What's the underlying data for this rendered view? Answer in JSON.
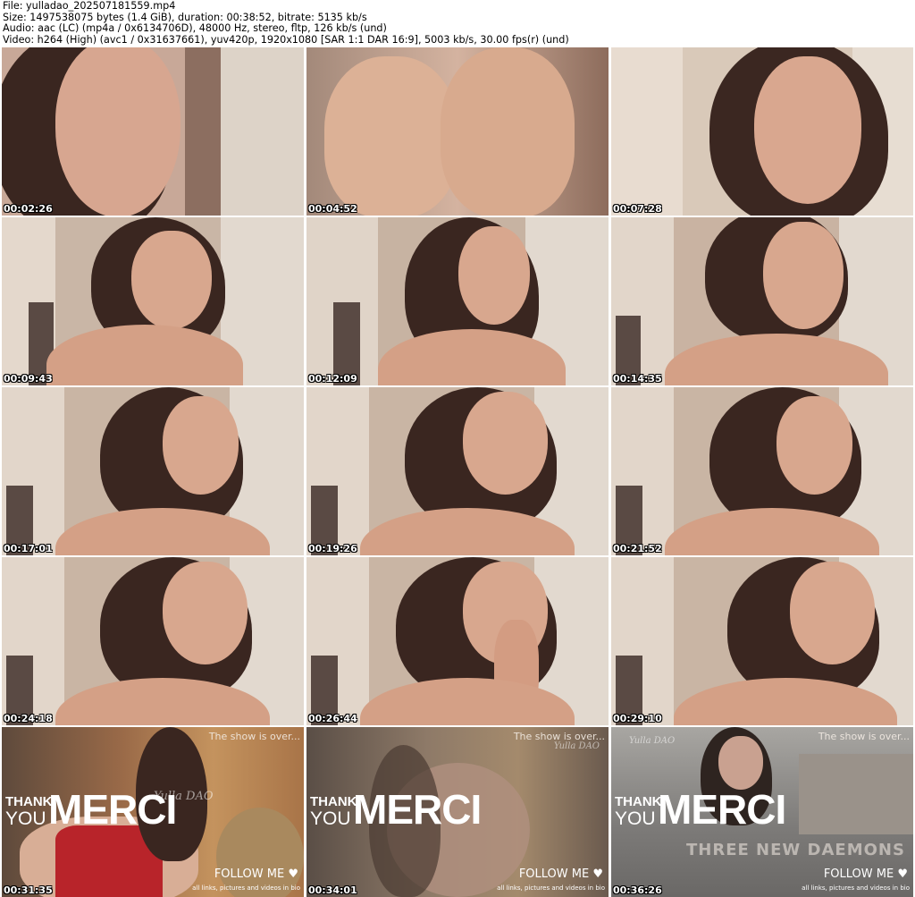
{
  "header": {
    "file": "File: yulladao_202507181559.mp4",
    "size": "Size: 1497538075 bytes (1.4 GiB), duration: 00:38:52, bitrate: 5135 kb/s",
    "audio": "Audio: aac (LC) (mp4a / 0x6134706D), 48000 Hz, stereo, fltp, 126 kb/s (und)",
    "video": "Video: h264 (High) (avc1 / 0x31637661), yuv420p, 1920x1080 [SAR 1:1 DAR 16:9], 5003 kb/s, 30.00 fps(r) (und)"
  },
  "thumbnails": [
    {
      "time": "00:02:26"
    },
    {
      "time": "00:04:52"
    },
    {
      "time": "00:07:28"
    },
    {
      "time": "00:09:43"
    },
    {
      "time": "00:12:09"
    },
    {
      "time": "00:14:35"
    },
    {
      "time": "00:17:01"
    },
    {
      "time": "00:19:26"
    },
    {
      "time": "00:21:52"
    },
    {
      "time": "00:24:18"
    },
    {
      "time": "00:26:44"
    },
    {
      "time": "00:29:10"
    },
    {
      "time": "00:31:35"
    },
    {
      "time": "00:34:01"
    },
    {
      "time": "00:36:26"
    }
  ],
  "endcard": {
    "show_over": "The show is over...",
    "thank": "THANK",
    "you": "YOU",
    "merci": "MERCI",
    "follow": "FOLLOW ME ♥",
    "links": "all links, pictures and videos in bio",
    "watermark": "Yulla DAO",
    "daemons": "THREE NEW DAEMONS"
  },
  "colors": {
    "skin": "#d9a58c",
    "hair": "#3a2620",
    "wall": "#c9b4a4",
    "curtain": "#e2d9cf",
    "timestamp": "#ffffff"
  }
}
